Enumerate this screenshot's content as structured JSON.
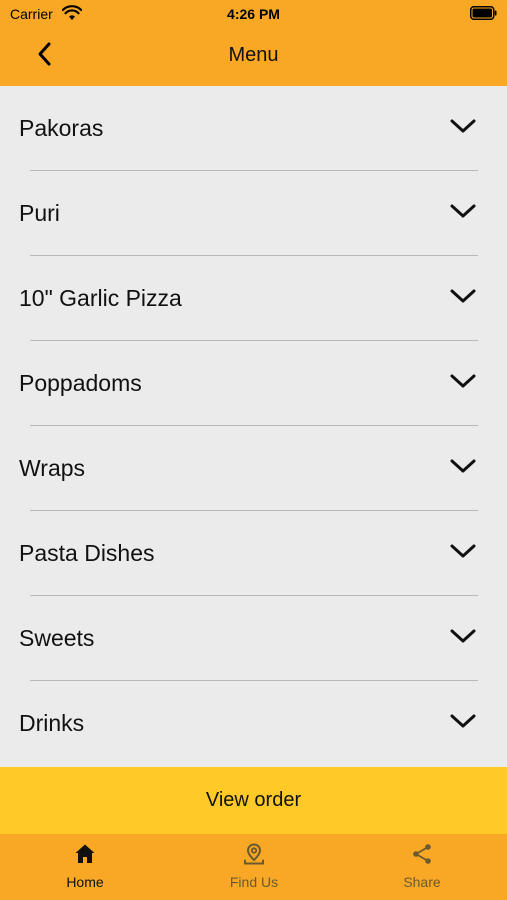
{
  "status_bar": {
    "carrier": "Carrier",
    "time": "4:26 PM"
  },
  "nav": {
    "title": "Menu",
    "back_icon": "chevron-left-icon"
  },
  "menu": {
    "categories": [
      {
        "label": "Pakoras",
        "icon": "chevron-down-icon"
      },
      {
        "label": "Puri",
        "icon": "chevron-down-icon"
      },
      {
        "label": "10\" Garlic Pizza",
        "icon": "chevron-down-icon"
      },
      {
        "label": "Poppadoms",
        "icon": "chevron-down-icon"
      },
      {
        "label": "Wraps",
        "icon": "chevron-down-icon"
      },
      {
        "label": "Pasta Dishes",
        "icon": "chevron-down-icon"
      },
      {
        "label": "Sweets",
        "icon": "chevron-down-icon"
      },
      {
        "label": "Drinks",
        "icon": "chevron-down-icon"
      }
    ]
  },
  "view_order": {
    "label": "View order"
  },
  "tabs": [
    {
      "label": "Home",
      "icon": "home-icon",
      "active": true
    },
    {
      "label": "Find Us",
      "icon": "map-pin-icon",
      "active": false
    },
    {
      "label": "Share",
      "icon": "share-icon",
      "active": false
    }
  ],
  "colors": {
    "header": "#f9a825",
    "view_order_bar": "#ffca28",
    "tab_bar": "#f9a825",
    "list_background": "#ebebeb",
    "separator": "#b8b8b8"
  }
}
